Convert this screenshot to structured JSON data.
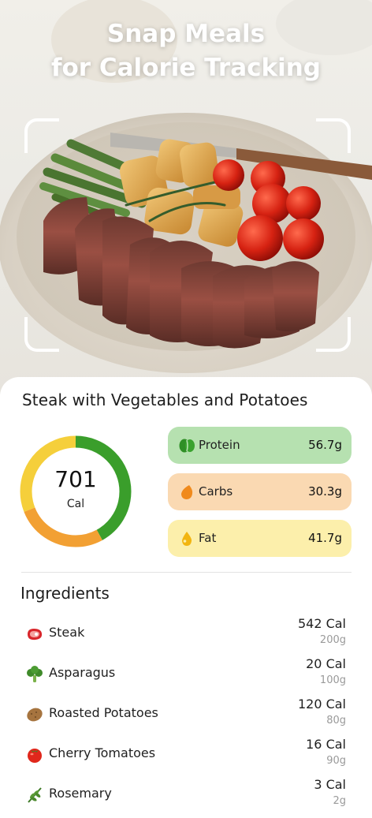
{
  "hero": {
    "headline_line1": "Snap Meals",
    "headline_line2": "for Calorie Tracking"
  },
  "result": {
    "meal_name": "Steak with Vegetables and Potatoes",
    "calories": {
      "value": "701",
      "unit": "Cal",
      "ring_segments": [
        {
          "macro": "protein",
          "fraction": 0.42,
          "color": "#3a9e2b"
        },
        {
          "macro": "carbs",
          "fraction": 0.27,
          "color": "#f2a033"
        },
        {
          "macro": "fat",
          "fraction": 0.31,
          "color": "#f5cf3b"
        }
      ]
    },
    "macros": [
      {
        "label": "Protein",
        "value": "56.7g",
        "icon": "protein-bean-icon",
        "bg": "#b6e1b0"
      },
      {
        "label": "Carbs",
        "value": "30.3g",
        "icon": "carbs-drop-icon",
        "bg": "#fad9b2"
      },
      {
        "label": "Fat",
        "value": "41.7g",
        "icon": "fat-drop-icon",
        "bg": "#fcefab"
      }
    ]
  },
  "ingredients": {
    "heading": "Ingredients",
    "items": [
      {
        "name": "Steak",
        "calories": "542 Cal",
        "weight": "200g",
        "icon": "steak-icon"
      },
      {
        "name": "Asparagus",
        "calories": "20 Cal",
        "weight": "100g",
        "icon": "broccoli-icon"
      },
      {
        "name": "Roasted Potatoes",
        "calories": "120 Cal",
        "weight": "80g",
        "icon": "potato-icon"
      },
      {
        "name": "Cherry Tomatoes",
        "calories": "16 Cal",
        "weight": "90g",
        "icon": "tomato-icon"
      },
      {
        "name": "Rosemary",
        "calories": "3 Cal",
        "weight": "2g",
        "icon": "herb-icon"
      }
    ]
  }
}
